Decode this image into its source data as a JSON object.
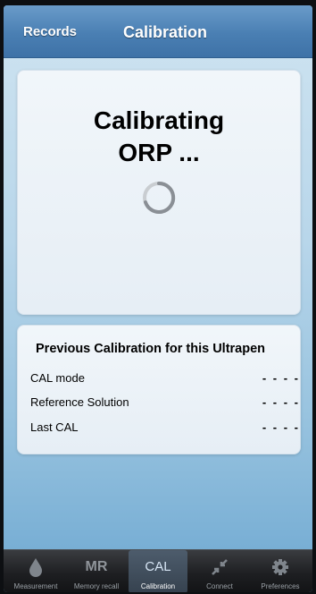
{
  "navbar": {
    "back_label": "Records",
    "title": "Calibration"
  },
  "status": {
    "line1": "Calibrating",
    "line2": "ORP ..."
  },
  "previous": {
    "title": "Previous Calibration for this Ultrapen",
    "rows": [
      {
        "label": "CAL mode",
        "value": "- - - -"
      },
      {
        "label": "Reference Solution",
        "value": "- - - -"
      },
      {
        "label": "Last CAL",
        "value": "- - - -"
      }
    ]
  },
  "tabbar": {
    "active_color": "#d7e6f5",
    "tabs": [
      {
        "label": "Measurement",
        "icon": "droplet-icon"
      },
      {
        "label": "Memory recall",
        "icon_text": "MR"
      },
      {
        "label": "Calibration",
        "icon_text": "CAL"
      },
      {
        "label": "Connect",
        "icon": "connect-arrows-icon"
      },
      {
        "label": "Preferences",
        "icon": "gear-icon"
      }
    ]
  }
}
